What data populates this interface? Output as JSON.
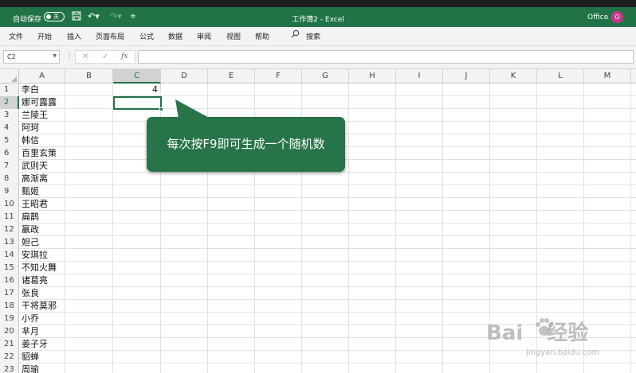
{
  "titlebar": {
    "autosave_label": "自动保存",
    "autosave_state": "关",
    "doc_title": "工作簿2  -  Excel",
    "office_label": "Office",
    "avatar_letter": "O",
    "accent_color": "#217346",
    "avatar_color": "#c8358c"
  },
  "ribbon": {
    "tabs": [
      "文件",
      "开始",
      "插入",
      "页面布局",
      "公式",
      "数据",
      "审阅",
      "视图",
      "帮助"
    ],
    "search_label": "搜索"
  },
  "formula_bar": {
    "name_box": "C2",
    "cancel_glyph": "✕",
    "enter_glyph": "✓",
    "fx_glyph": "fx",
    "formula": ""
  },
  "grid": {
    "columns": [
      "A",
      "B",
      "C",
      "D",
      "E",
      "F",
      "G",
      "H",
      "I",
      "J",
      "K",
      "L",
      "M"
    ],
    "active_column": "C",
    "active_row": "2",
    "rows": [
      "1",
      "2",
      "3",
      "4",
      "5",
      "6",
      "7",
      "8",
      "9",
      "10",
      "11",
      "12",
      "13",
      "14",
      "15",
      "16",
      "17",
      "18",
      "19",
      "20",
      "21",
      "22",
      "23"
    ],
    "column_a": [
      "李白",
      "娜可露露",
      "兰陵王",
      "阿珂",
      "韩信",
      "百里玄策",
      "武则天",
      "高渐离",
      "甄姬",
      "王昭君",
      "扁鹊",
      "嬴政",
      "妲己",
      "安琪拉",
      "不知火舞",
      "诸葛亮",
      "张良",
      "干将莫邪",
      "小乔",
      "芈月",
      "姜子牙",
      "貂蝉",
      "周瑜"
    ],
    "c1_value": "4"
  },
  "callout": {
    "text": "每次按F9即可生成一个随机数"
  },
  "watermark": {
    "brand": "Bai",
    "brand2": "经验",
    "url": "jingyan.baidu.com"
  }
}
